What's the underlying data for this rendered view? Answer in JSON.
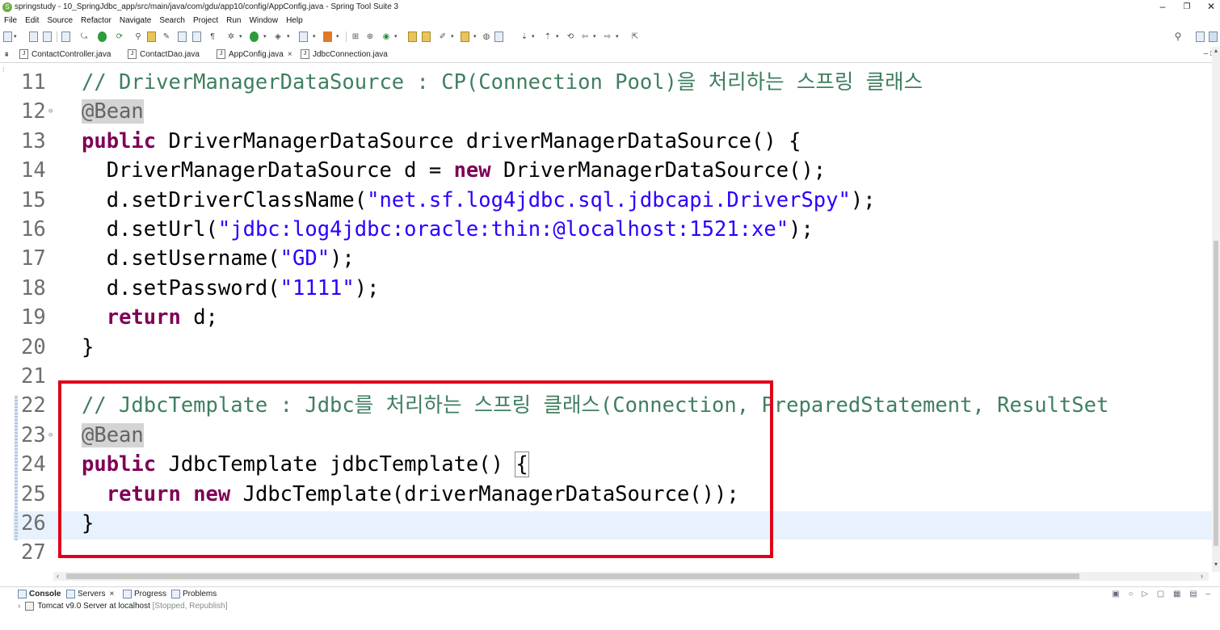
{
  "window": {
    "title": "springstudy - 10_SpringJdbc_app/src/main/java/com/gdu/app10/config/AppConfig.java - Spring Tool Suite 3",
    "minimize": "–",
    "restore": "❐",
    "close": "✕"
  },
  "menu": [
    "File",
    "Edit",
    "Source",
    "Refactor",
    "Navigate",
    "Search",
    "Project",
    "Run",
    "Window",
    "Help"
  ],
  "tabs": [
    {
      "label": "ContactController.java",
      "active": false,
      "closable": false
    },
    {
      "label": "ContactDao.java",
      "active": false,
      "closable": false
    },
    {
      "label": "AppConfig.java",
      "active": true,
      "closable": true
    },
    {
      "label": "JdbcConnection.java",
      "active": false,
      "closable": false
    }
  ],
  "tab_close": "×",
  "tab_minmax": "–  □",
  "code": {
    "lines": [
      {
        "num": "11",
        "fold": "",
        "segments": [
          {
            "t": "// DriverManagerDataSource : CP(Connection Pool)을 처리하는 스프링 클래스",
            "c": "cm"
          }
        ]
      },
      {
        "num": "12",
        "fold": "⊖",
        "segments": [
          {
            "t": "@Bean",
            "c": "an"
          }
        ]
      },
      {
        "num": "13",
        "fold": "",
        "segments": [
          {
            "t": "public",
            "c": "kw"
          },
          {
            "t": " DriverManagerDataSource driverManagerDataSource() {",
            "c": ""
          }
        ]
      },
      {
        "num": "14",
        "fold": "",
        "segments": [
          {
            "t": "  DriverManagerDataSource d = ",
            "c": ""
          },
          {
            "t": "new",
            "c": "kw"
          },
          {
            "t": " DriverManagerDataSource();",
            "c": ""
          }
        ]
      },
      {
        "num": "15",
        "fold": "",
        "segments": [
          {
            "t": "  d.setDriverClassName(",
            "c": ""
          },
          {
            "t": "\"net.sf.log4jdbc.sql.jdbcapi.DriverSpy\"",
            "c": "st"
          },
          {
            "t": ");",
            "c": ""
          }
        ]
      },
      {
        "num": "16",
        "fold": "",
        "segments": [
          {
            "t": "  d.setUrl(",
            "c": ""
          },
          {
            "t": "\"jdbc:log4jdbc:oracle:thin:@localhost:1521:xe\"",
            "c": "st"
          },
          {
            "t": ");",
            "c": ""
          }
        ]
      },
      {
        "num": "17",
        "fold": "",
        "segments": [
          {
            "t": "  d.setUsername(",
            "c": ""
          },
          {
            "t": "\"GD\"",
            "c": "st"
          },
          {
            "t": ");",
            "c": ""
          }
        ]
      },
      {
        "num": "18",
        "fold": "",
        "segments": [
          {
            "t": "  d.setPassword(",
            "c": ""
          },
          {
            "t": "\"1111\"",
            "c": "st"
          },
          {
            "t": ");",
            "c": ""
          }
        ]
      },
      {
        "num": "19",
        "fold": "",
        "segments": [
          {
            "t": "  ",
            "c": ""
          },
          {
            "t": "return",
            "c": "kw"
          },
          {
            "t": " d;",
            "c": ""
          }
        ]
      },
      {
        "num": "20",
        "fold": "",
        "segments": [
          {
            "t": "}",
            "c": ""
          }
        ]
      },
      {
        "num": "21",
        "fold": "",
        "segments": []
      },
      {
        "num": "22",
        "fold": "",
        "segments": [
          {
            "t": "// JdbcTemplate : Jdbc를 처리하는 스프링 클래스(Connection, PreparedStatement, ResultSet",
            "c": "cm"
          }
        ]
      },
      {
        "num": "23",
        "fold": "⊖",
        "segments": [
          {
            "t": "@Bean",
            "c": "an"
          }
        ]
      },
      {
        "num": "24",
        "fold": "",
        "segments": [
          {
            "t": "public",
            "c": "kw"
          },
          {
            "t": " JdbcTemplate jdbcTemplate() ",
            "c": ""
          },
          {
            "t": "{",
            "c": "bracket-box"
          }
        ]
      },
      {
        "num": "25",
        "fold": "",
        "segments": [
          {
            "t": "  ",
            "c": ""
          },
          {
            "t": "return",
            "c": "kw"
          },
          {
            "t": " ",
            "c": ""
          },
          {
            "t": "new",
            "c": "kw"
          },
          {
            "t": " JdbcTemplate(driverManagerDataSource());",
            "c": ""
          }
        ]
      },
      {
        "num": "26",
        "fold": "",
        "segments": [
          {
            "t": "}",
            "c": ""
          }
        ]
      },
      {
        "num": "27",
        "fold": "",
        "segments": []
      }
    ]
  },
  "scroll": {
    "up": "▴",
    "down": "▾",
    "left": "‹",
    "right": "›"
  },
  "bottom_tabs": [
    {
      "label": "Console",
      "active": true,
      "closable": false
    },
    {
      "label": "Servers",
      "active": false,
      "closable": true
    },
    {
      "label": "Progress",
      "active": false,
      "closable": false
    },
    {
      "label": "Problems",
      "active": false,
      "closable": false
    }
  ],
  "server": {
    "chevron": "›",
    "name": "Tomcat v9.0 Server at localhost",
    "status": "[Stopped, Republish]"
  },
  "panel_tools": "▣ ○ ▷ ▢ ▦ ▤ –",
  "colors": {
    "highlight_box": "#e0001b",
    "comment": "#3f7f5f",
    "keyword": "#7f0055",
    "string": "#2a00ff",
    "current_line": "#e8f2fe"
  }
}
